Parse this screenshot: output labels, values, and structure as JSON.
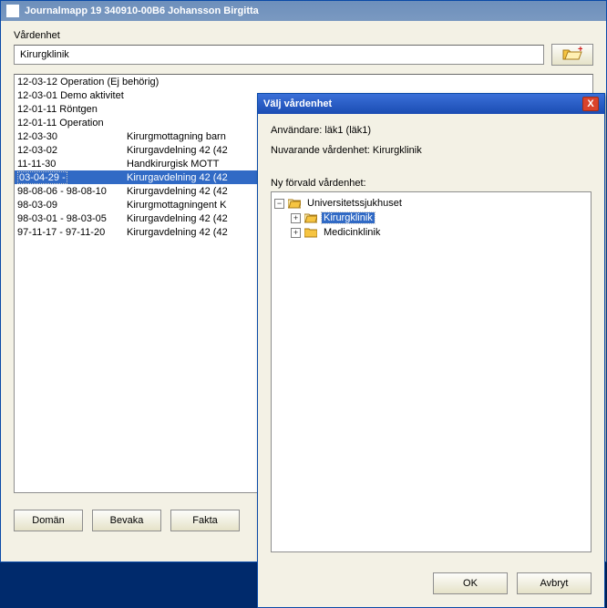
{
  "window": {
    "title": "Journalmapp 19 340910-00B6  Johansson Birgitta"
  },
  "unit": {
    "label": "Vårdenhet",
    "value": "Kirurgklinik"
  },
  "entries": [
    {
      "date": "12-03-12",
      "text": "Operation (Ej behörig)",
      "singleCol": true
    },
    {
      "date": "12-03-01",
      "text": "Demo aktivitet",
      "singleCol": true
    },
    {
      "date": "12-01-11",
      "text": "Röntgen",
      "singleCol": true
    },
    {
      "date": "12-01-11",
      "text": "Operation",
      "singleCol": true
    },
    {
      "date": "12-03-30",
      "text": "Kirurgmottagning barn"
    },
    {
      "date": "12-03-02",
      "text": "Kirurgavdelning 42 (42"
    },
    {
      "date": "11-11-30",
      "text": "Handkirurgisk MOTT"
    },
    {
      "date": "03-04-29 -",
      "text": "Kirurgavdelning 42 (42",
      "selected": true
    },
    {
      "date": "98-08-06 - 98-08-10",
      "text": "Kirurgavdelning 42 (42"
    },
    {
      "date": "98-03-09",
      "text": "Kirurgmottagningent K"
    },
    {
      "date": "98-03-01 - 98-03-05",
      "text": "Kirurgavdelning 42 (42"
    },
    {
      "date": "97-11-17 - 97-11-20",
      "text": "Kirurgavdelning 42 (42"
    }
  ],
  "buttons": {
    "doman": "Domän",
    "bevaka": "Bevaka",
    "fakta": "Fakta"
  },
  "dialog": {
    "title": "Välj vårdenhet",
    "user_line": "Användare: läk1 (läk1)",
    "current_line": "Nuvarande vårdenhet: Kirurgklinik",
    "new_label": "Ny förvald vårdenhet:",
    "tree": {
      "root": "Universitetssjukhuset",
      "children": [
        {
          "label": "Kirurgklinik",
          "selected": true,
          "open": false,
          "expandable": true
        },
        {
          "label": "Medicinklinik",
          "selected": false,
          "open": false,
          "expandable": true
        }
      ]
    },
    "ok": "OK",
    "cancel": "Avbryt"
  },
  "glyphs": {
    "minus": "−",
    "plus": "+",
    "x": "X"
  }
}
